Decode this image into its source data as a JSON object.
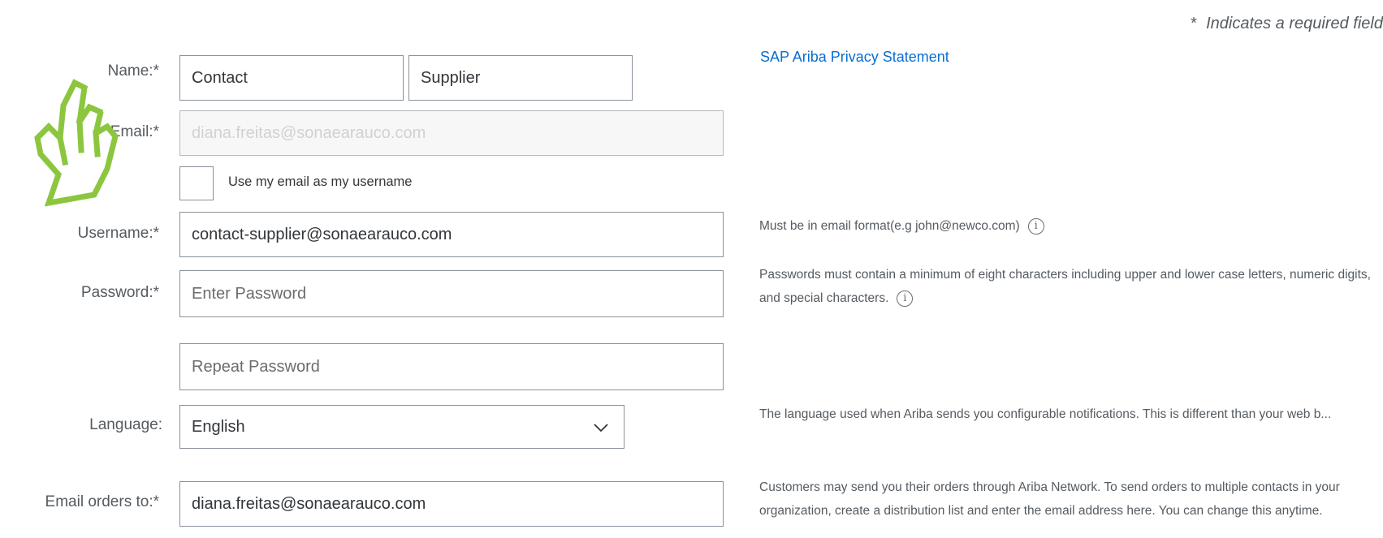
{
  "header": {
    "required_note_star": "*",
    "required_note": "Indicates a required field"
  },
  "privacy_link": "SAP Ariba Privacy Statement",
  "form": {
    "name_label": "Name:",
    "first_name": "Contact",
    "last_name": "Supplier",
    "email_label": "Email:",
    "email_value": "diana.freitas@sonaearauco.com",
    "use_email_checkbox_label": "Use my email as my username",
    "use_email_checked": false,
    "username_label": "Username:",
    "username_value": "contact-supplier@sonaearauco.com",
    "password_label": "Password:",
    "password_placeholder": "Enter Password",
    "repeat_password_placeholder": "Repeat Password",
    "language_label": "Language:",
    "language_value": "English",
    "email_orders_label": "Email orders to:",
    "email_orders_value": "diana.freitas@sonaearauco.com",
    "required_star": "*"
  },
  "help": {
    "username": "Must be in email format(e.g john@newco.com)",
    "password": "Passwords must contain a minimum of eight characters including upper and lower case letters, numeric digits, and special characters.",
    "language": "The language used when Ariba sends you configurable notifications. This is different than your web b...",
    "email_orders": "Customers may send you their orders through Ariba Network. To send orders to multiple contacts in your organization, create a distribution list and enter the email address here. You can change this anytime."
  },
  "info_icon_glyph": "i",
  "colors": {
    "link": "#0a6ed1",
    "cursor_overlay": "#8cc63f"
  },
  "icons": [
    "info-icon",
    "chevron-down-icon",
    "hand-cursor-icon"
  ]
}
